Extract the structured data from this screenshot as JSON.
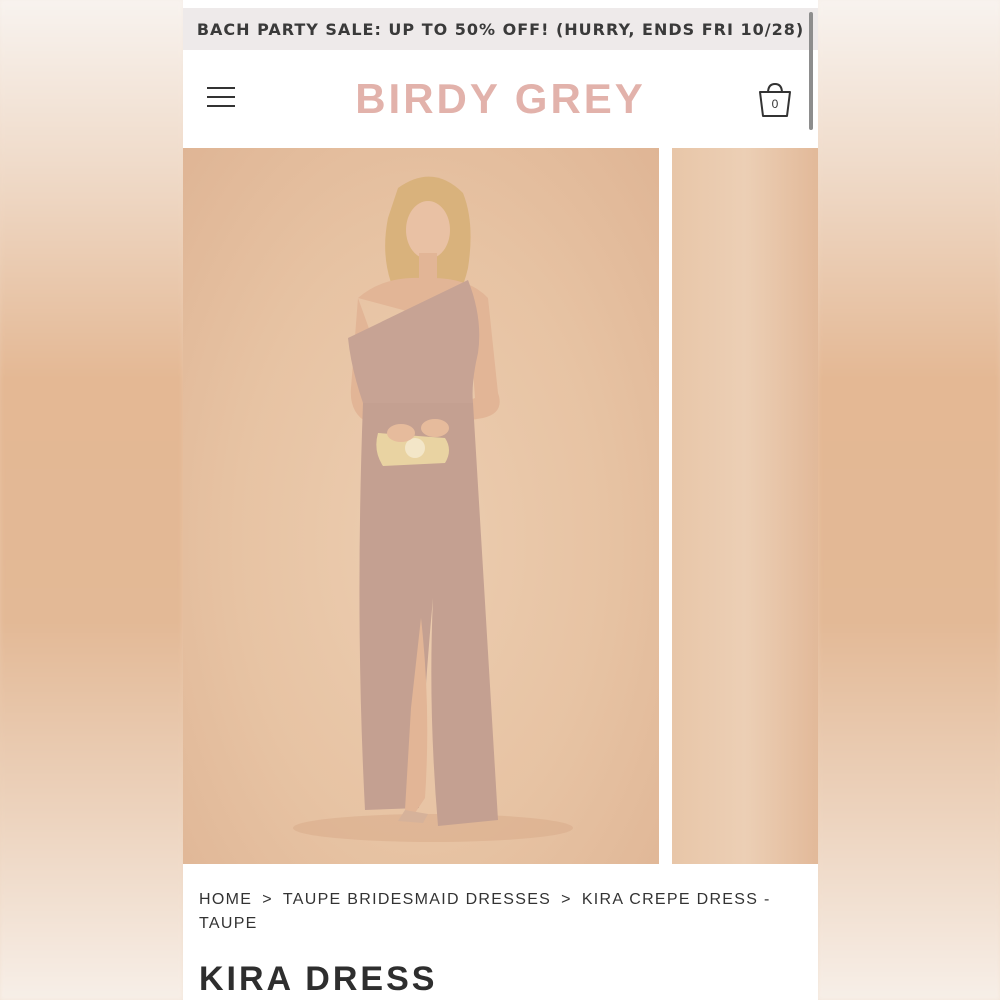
{
  "promo": {
    "text": "BACH PARTY SALE: UP TO 50% OFF! (HURRY, ENDS FRI 10/28)"
  },
  "header": {
    "logo": "BIRDY GREY",
    "cart_count": "0",
    "logo_color": "#e2b2ab"
  },
  "icons": {
    "menu": "hamburger-menu-icon",
    "cart": "shopping-bag-icon"
  },
  "gallery": {
    "main_image": "model in taupe one-shoulder crepe dress holding clutch",
    "next_image": "next product image (partially visible)"
  },
  "breadcrumb": {
    "items": [
      "HOME",
      "TAUPE BRIDESMAID DRESSES",
      "KIRA CREPE DRESS - TAUPE"
    ],
    "separator": ">"
  },
  "product": {
    "title": "KIRA DRESS"
  },
  "colors": {
    "dress": "#c5a293",
    "background": "#e7c3a3"
  }
}
